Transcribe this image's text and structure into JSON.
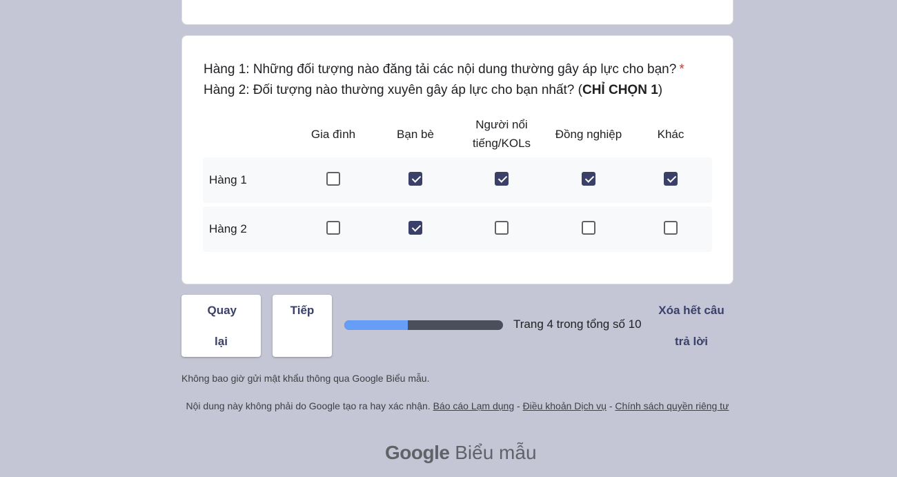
{
  "question": {
    "line1": "Hàng 1: Những đối tượng nào đăng tải các nội dung thường gây áp lực cho bạn?",
    "required_mark": "*",
    "line2_prefix": "Hàng 2: Đối tượng nào thường xuyên gây áp lực cho bạn nhất? (",
    "line2_bold": "CHỈ CHỌN 1",
    "line2_suffix": ")"
  },
  "grid": {
    "columns": [
      "Gia đình",
      "Bạn bè",
      "Người nổi tiếng/KOLs",
      "Đồng nghiệp",
      "Khác"
    ],
    "rows": [
      {
        "label": "Hàng 1",
        "checked": [
          false,
          true,
          true,
          true,
          true
        ]
      },
      {
        "label": "Hàng 2",
        "checked": [
          false,
          true,
          false,
          false,
          false
        ]
      }
    ]
  },
  "nav": {
    "back_label": "Quay lại",
    "next_label": "Tiếp",
    "clear_label": "Xóa hết câu trả lời"
  },
  "progress": {
    "text": "Trang 4 trong tổng số 10",
    "fraction": 0.4
  },
  "footer": {
    "password_note": "Không bao giờ gửi mật khẩu thông qua Google Biểu mẫu.",
    "disclaimer_text": "Nội dung này không phải do Google tạo ra hay xác nhận.",
    "link_report": "Báo cáo Lạm dụng",
    "link_terms": "Điều khoản Dịch vụ",
    "link_privacy": "Chính sách quyền riêng tư",
    "separator": "-",
    "brand_google": "Google",
    "brand_forms": "Biểu mẫu"
  },
  "colors": {
    "background": "#c4c6d5",
    "accent": "#3b4069",
    "required": "#d93025",
    "progress_fill": "#669df6",
    "progress_track": "#4a4f5b"
  }
}
